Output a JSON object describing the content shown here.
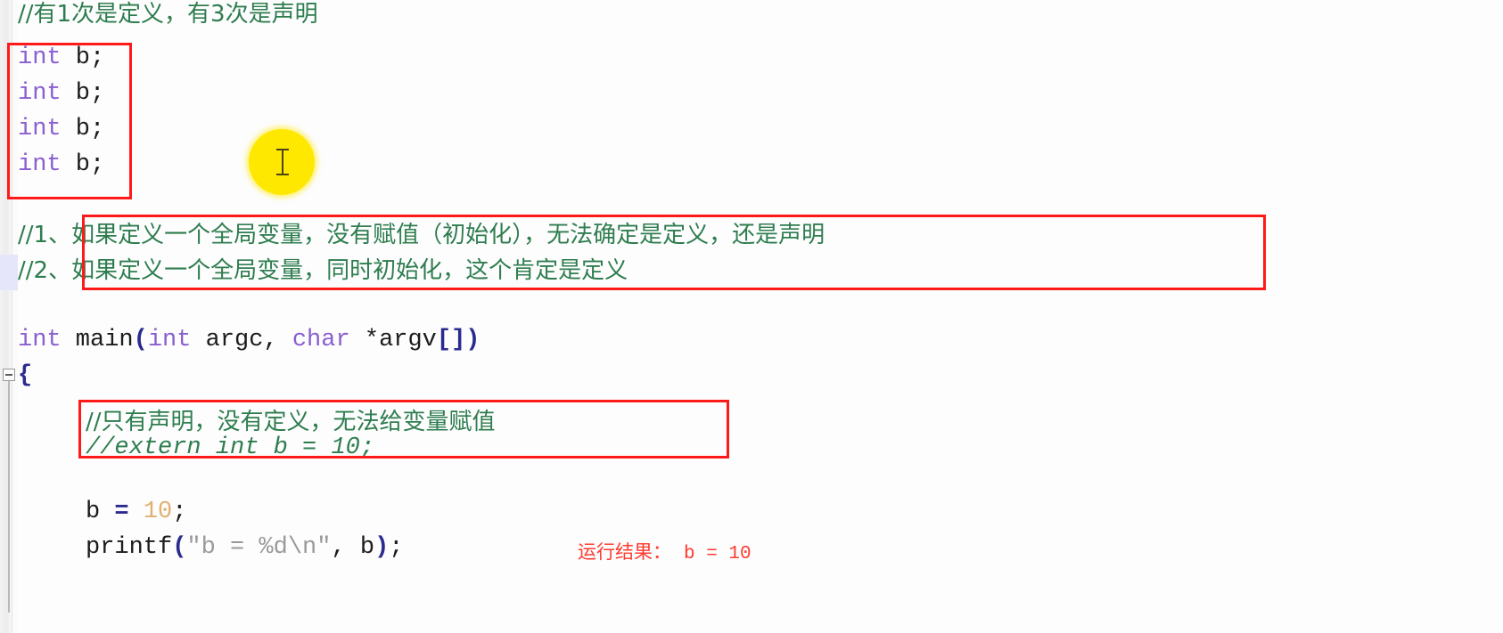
{
  "editor": {
    "title": "C source code editor view",
    "background_color": "#fdfdfd",
    "selection_color": "#e6e6fa",
    "annotation_color": "#ff1a1a",
    "comment_color": "#2e7d4f",
    "keyword_color": "#8a5fd0",
    "number_color": "#e0b070",
    "string_color": "#9a9a9a",
    "paren_color": "#2b2b8f"
  },
  "lines": {
    "l1_comment": "//有1次是定义，有3次是声明",
    "l2_kw": "int",
    "l2_rest": " b;",
    "l3_kw": "int",
    "l3_rest": " b;",
    "l4_kw": "int",
    "l4_rest": " b;",
    "l5_kw": "int",
    "l5_rest": " b;",
    "l6_prefix": "//1、",
    "l6_text": "如果定义一个全局变量，没有赋值（初始化），无法确定是定义，还是声明",
    "l7_prefix": "//2、",
    "l7_text": "如果定义一个全局变量，同时初始化，这个肯定是定义",
    "main_kw1": "int",
    "main_name": " main",
    "main_p1": "(",
    "main_kw2": "int",
    "main_arg1": " argc, ",
    "main_kw3": "char",
    "main_arg2": " *argv",
    "main_brackets": "[]",
    "main_p2": ")",
    "open_brace": "{",
    "body_comment1": "//只有声明，没有定义，无法给变量赋值",
    "body_comment2": "//extern int b = 10;",
    "assign_var": "b ",
    "assign_op": "= ",
    "assign_num": "10",
    "assign_end": ";",
    "printf_name": "printf",
    "printf_open": "(",
    "printf_str": "\"b = %d\\n\"",
    "printf_mid": ", b",
    "printf_close": ")",
    "printf_end": ";"
  },
  "annotations": {
    "result_label": "运行结果：",
    "result_value": "b = 10",
    "boxes": [
      {
        "name": "global-declarations-box"
      },
      {
        "name": "global-rules-box"
      },
      {
        "name": "extern-comment-box"
      }
    ]
  },
  "cursor": {
    "icon": "text-ibeam-cursor",
    "highlight_color": "#ffe800"
  },
  "gutter": {
    "fold_icon": "collapse-minus-icon"
  }
}
